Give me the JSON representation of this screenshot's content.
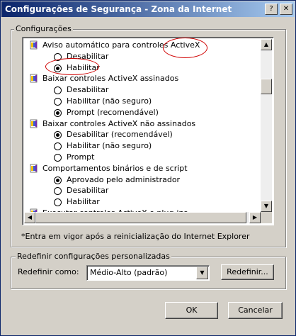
{
  "window": {
    "title": "Configurações de Segurança - Zona da Internet",
    "help_glyph": "?",
    "close_glyph": "✕"
  },
  "settings_group": {
    "label": "Configurações",
    "items": [
      {
        "kind": "heading",
        "label": "Aviso automático para controles ActiveX"
      },
      {
        "kind": "option",
        "label": "Desabilitar",
        "selected": false
      },
      {
        "kind": "option",
        "label": "Habilitar",
        "selected": true
      },
      {
        "kind": "heading",
        "label": "Baixar controles ActiveX assinados"
      },
      {
        "kind": "option",
        "label": "Desabilitar",
        "selected": false
      },
      {
        "kind": "option",
        "label": "Habilitar (não seguro)",
        "selected": false
      },
      {
        "kind": "option",
        "label": "Prompt (recomendável)",
        "selected": true
      },
      {
        "kind": "heading",
        "label": "Baixar controles ActiveX não assinados"
      },
      {
        "kind": "option",
        "label": "Desabilitar (recomendável)",
        "selected": true
      },
      {
        "kind": "option",
        "label": "Habilitar (não seguro)",
        "selected": false
      },
      {
        "kind": "option",
        "label": "Prompt",
        "selected": false
      },
      {
        "kind": "heading",
        "label": "Comportamentos binários e de script"
      },
      {
        "kind": "option",
        "label": "Aprovado pelo administrador",
        "selected": true
      },
      {
        "kind": "option",
        "label": "Desabilitar",
        "selected": false
      },
      {
        "kind": "option",
        "label": "Habilitar",
        "selected": false
      },
      {
        "kind": "heading",
        "label": "Executar controles ActiveX e plug-ins"
      }
    ],
    "footnote": "*Entra em vigor após a reinicialização do Internet Explorer"
  },
  "reset_group": {
    "label": "Redefinir configurações personalizadas",
    "reset_to_label": "Redefinir como:",
    "selected_level": "Médio-Alto (padrão)",
    "reset_button": "Redefinir..."
  },
  "footer": {
    "ok_button": "OK",
    "cancel_button": "Cancelar"
  },
  "annotation_color": "#d00000"
}
